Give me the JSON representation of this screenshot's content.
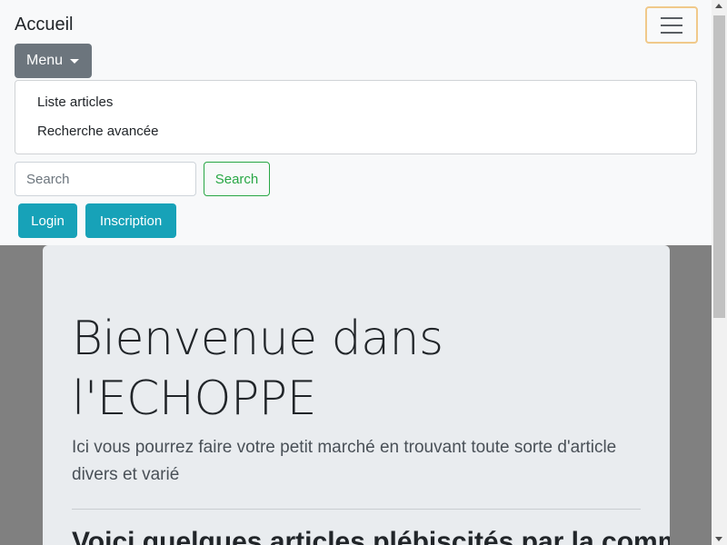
{
  "navbar": {
    "brand": "Accueil",
    "toggler_icon": "hamburger-icon",
    "menu_label": "Menu",
    "dropdown_items": [
      "Liste articles",
      "Recherche avancée"
    ],
    "search": {
      "placeholder": "Search",
      "value": ""
    },
    "search_button": "Search",
    "login_button": "Login",
    "signup_button": "Inscription"
  },
  "jumbotron": {
    "title": "Bienvenue dans l'ECHOPPE",
    "lead": "Ici vous pourrez faire votre petit marché en trouvant toute sorte d'article divers et varié",
    "subheading": "Voici quelques articles plébiscités par la communauté"
  },
  "colors": {
    "navbar_bg": "#f8f9fa",
    "secondary": "#6c757d",
    "success": "#28a745",
    "info": "#17a2b8",
    "jumbotron_bg": "#e9ecef",
    "page_bg": "#808080"
  }
}
